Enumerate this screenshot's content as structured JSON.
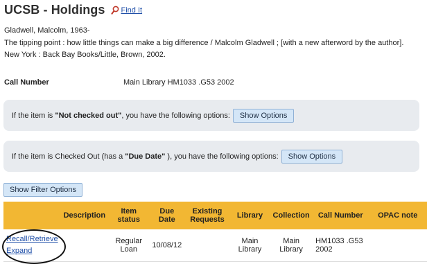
{
  "header": {
    "title": "UCSB - Holdings",
    "find_icon": "magnifier-icon",
    "find_link": "Find It"
  },
  "bib": {
    "author": "Gladwell, Malcolm, 1963-",
    "title_line": "The tipping point :   how little things can make a big difference /    Malcolm Gladwell ; [with a new afterword by the author].",
    "publication": "New York : Back Bay Books/Little, Brown, 2002."
  },
  "call_number": {
    "label": "Call Number",
    "value": "Main Library HM1033 .G53 2002"
  },
  "panels": {
    "not_checked_out": {
      "prefix": "If the item is ",
      "emphasis": "\"Not checked out\"",
      "suffix": ", you have the following options:",
      "button": "Show Options"
    },
    "checked_out": {
      "prefix": "If the item is Checked Out (has a ",
      "emphasis": "\"Due Date\"",
      "suffix": " ), you have the following options:",
      "button": "Show Options"
    }
  },
  "filter_button": "Show Filter Options",
  "table": {
    "headers": [
      "",
      "Description",
      "Item status",
      "Due Date",
      "Existing Requests",
      "Library",
      "Collection",
      "Call Number",
      "OPAC note"
    ],
    "row": {
      "actions": [
        "Recall/Retrieve",
        "Expand"
      ],
      "description": "",
      "status": "Regular Loan",
      "due_date": "10/08/12",
      "requests": "",
      "library": "Main Library",
      "collection": "Main Library",
      "call_number": "HM1033 .G53 2002",
      "opac_note": ""
    }
  },
  "colors": {
    "header_bg": "#f2b733",
    "panel_bg": "#e8ebef",
    "link": "#1f4fa8",
    "button_bg": "#d4e6f7"
  }
}
